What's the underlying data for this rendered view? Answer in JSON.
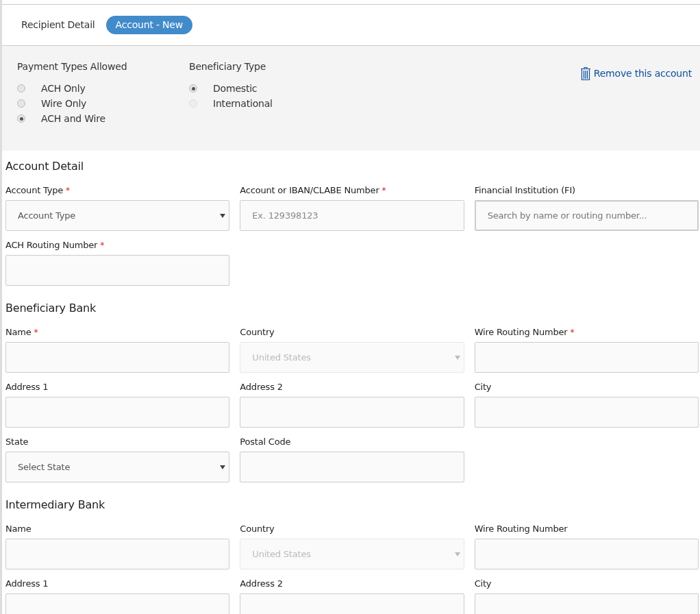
{
  "tabs": [
    {
      "label": "Recipient Detail",
      "selected": false
    },
    {
      "label": "Account - New",
      "selected": true
    }
  ],
  "options": {
    "groups": [
      {
        "title": "Payment Types Allowed",
        "items": [
          {
            "label": "ACH Only",
            "selected": false,
            "disabled": false
          },
          {
            "label": "Wire Only",
            "selected": false,
            "disabled": false
          },
          {
            "label": "ACH and Wire",
            "selected": true,
            "disabled": false
          }
        ]
      },
      {
        "title": "Beneficiary Type",
        "items": [
          {
            "label": "Domestic",
            "selected": true,
            "disabled": false
          },
          {
            "label": "International",
            "selected": false,
            "disabled": true
          }
        ]
      }
    ],
    "remove_link": "Remove this account"
  },
  "sections": [
    {
      "title": "Account Detail",
      "rows": [
        [
          {
            "label": "Account Type",
            "required_mark": "*",
            "kind": "select",
            "value": "Account Type",
            "disabled": false
          },
          {
            "label": "Account or IBAN/CLABE Number",
            "required_mark": "*",
            "kind": "text",
            "placeholder": "Ex. 129398123",
            "disabled": false
          },
          {
            "label": "Financial Institution (FI)",
            "kind": "search",
            "placeholder": "Search by name or routing number...",
            "disabled": false
          }
        ],
        [
          {
            "label": "ACH Routing Number",
            "required_mark": "*",
            "kind": "text",
            "disabled": false
          }
        ]
      ]
    },
    {
      "title": "Beneficiary Bank",
      "rows": [
        [
          {
            "label": "Name",
            "required_mark": "*",
            "kind": "text",
            "disabled": false
          },
          {
            "label": "Country",
            "kind": "select",
            "value": "United States",
            "disabled": true
          },
          {
            "label": "Wire Routing Number",
            "required_mark": "*",
            "kind": "text",
            "disabled": false
          }
        ],
        [
          {
            "label": "Address 1",
            "kind": "text",
            "disabled": false
          },
          {
            "label": "Address 2",
            "kind": "text",
            "disabled": false
          },
          {
            "label": "City",
            "kind": "text",
            "disabled": false
          }
        ],
        [
          {
            "label": "State",
            "kind": "select",
            "value": "Select State",
            "disabled": false
          },
          {
            "label": "Postal Code",
            "kind": "text",
            "disabled": false
          }
        ]
      ]
    },
    {
      "title": "Intermediary Bank",
      "rows": [
        [
          {
            "label": "Name",
            "kind": "text",
            "disabled": false
          },
          {
            "label": "Country",
            "kind": "select",
            "value": "United States",
            "disabled": true
          },
          {
            "label": "Wire Routing Number",
            "kind": "text",
            "disabled": false
          }
        ],
        [
          {
            "label": "Address 1",
            "kind": "text",
            "disabled": false
          },
          {
            "label": "Address 2",
            "kind": "text",
            "disabled": false
          },
          {
            "label": "City",
            "kind": "text",
            "disabled": false
          }
        ]
      ]
    }
  ]
}
